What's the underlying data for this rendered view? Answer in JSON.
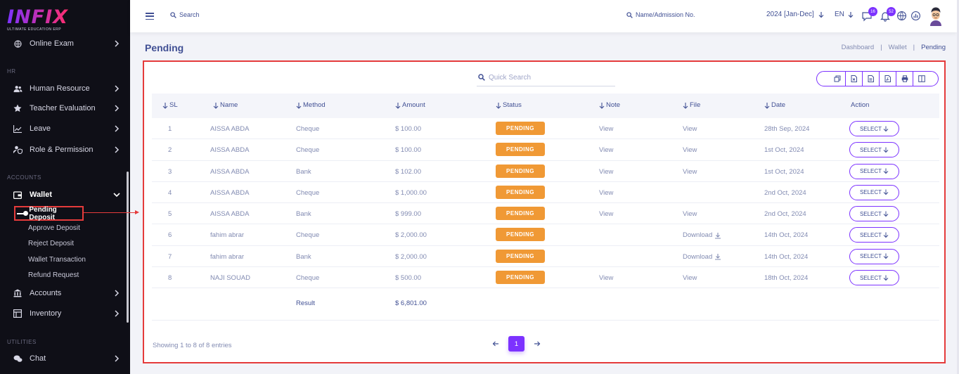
{
  "brand": {
    "logo_text": "INFIX",
    "tagline": "ULTIMATE EDUCATION ERP"
  },
  "sidebar": {
    "top_item": "Online Exam",
    "sections": {
      "hr": "HR",
      "accounts": "ACCOUNTS",
      "utilities": "UTILITIES"
    },
    "hr_items": [
      "Human Resource",
      "Teacher Evaluation",
      "Leave",
      "Role & Permission"
    ],
    "wallet": "Wallet",
    "wallet_sub": [
      "Pending Deposit",
      "Approve Deposit",
      "Reject Deposit",
      "Wallet Transaction",
      "Refund Request"
    ],
    "accounts_items": [
      "Accounts",
      "Inventory"
    ],
    "utilities_items": [
      "Chat"
    ]
  },
  "header": {
    "search_label": "Search",
    "admission_search": "Name/Admission No.",
    "session": "2024 [Jan-Dec]",
    "language": "EN",
    "messages_count": "16",
    "notifications_count": "52"
  },
  "page": {
    "title": "Pending",
    "breadcrumb": [
      "Dashboard",
      "Wallet",
      "Pending"
    ]
  },
  "table": {
    "quick_search_placeholder": "Quick Search",
    "columns": [
      "SL",
      "Name",
      "Method",
      "Amount",
      "Status",
      "Note",
      "File",
      "Date",
      "Action"
    ],
    "rows": [
      {
        "sl": "1",
        "name": "AISSA ABDA",
        "method": "Cheque",
        "amount": "$ 100.00",
        "status": "PENDING",
        "note": "View",
        "file": "View",
        "date": "28th Sep, 2024",
        "action": "SELECT"
      },
      {
        "sl": "2",
        "name": "AISSA ABDA",
        "method": "Cheque",
        "amount": "$ 100.00",
        "status": "PENDING",
        "note": "View",
        "file": "View",
        "date": "1st Oct, 2024",
        "action": "SELECT"
      },
      {
        "sl": "3",
        "name": "AISSA ABDA",
        "method": "Bank",
        "amount": "$ 102.00",
        "status": "PENDING",
        "note": "View",
        "file": "View",
        "date": "1st Oct, 2024",
        "action": "SELECT"
      },
      {
        "sl": "4",
        "name": "AISSA ABDA",
        "method": "Cheque",
        "amount": "$ 1,000.00",
        "status": "PENDING",
        "note": "View",
        "file": "",
        "date": "2nd Oct, 2024",
        "action": "SELECT"
      },
      {
        "sl": "5",
        "name": "AISSA ABDA",
        "method": "Bank",
        "amount": "$ 999.00",
        "status": "PENDING",
        "note": "View",
        "file": "View",
        "date": "2nd Oct, 2024",
        "action": "SELECT"
      },
      {
        "sl": "6",
        "name": "fahim abrar",
        "method": "Cheque",
        "amount": "$ 2,000.00",
        "status": "PENDING",
        "note": "",
        "file": "Download",
        "date": "14th Oct, 2024",
        "action": "SELECT"
      },
      {
        "sl": "7",
        "name": "fahim abrar",
        "method": "Bank",
        "amount": "$ 2,000.00",
        "status": "PENDING",
        "note": "",
        "file": "Download",
        "date": "14th Oct, 2024",
        "action": "SELECT"
      },
      {
        "sl": "8",
        "name": "NAJI SOUAD",
        "method": "Cheque",
        "amount": "$ 500.00",
        "status": "PENDING",
        "note": "View",
        "file": "View",
        "date": "18th Oct, 2024",
        "action": "SELECT"
      }
    ],
    "total_label": "Result",
    "total_amount": "$ 6,801.00",
    "showing": "Showing 1 to 8 of 8 entries",
    "current_page": "1"
  },
  "colors": {
    "primary": "#7c32ff",
    "pending": "#f09935",
    "annotation": "#e53b3b",
    "sidebar_bg": "#0f0f17"
  }
}
